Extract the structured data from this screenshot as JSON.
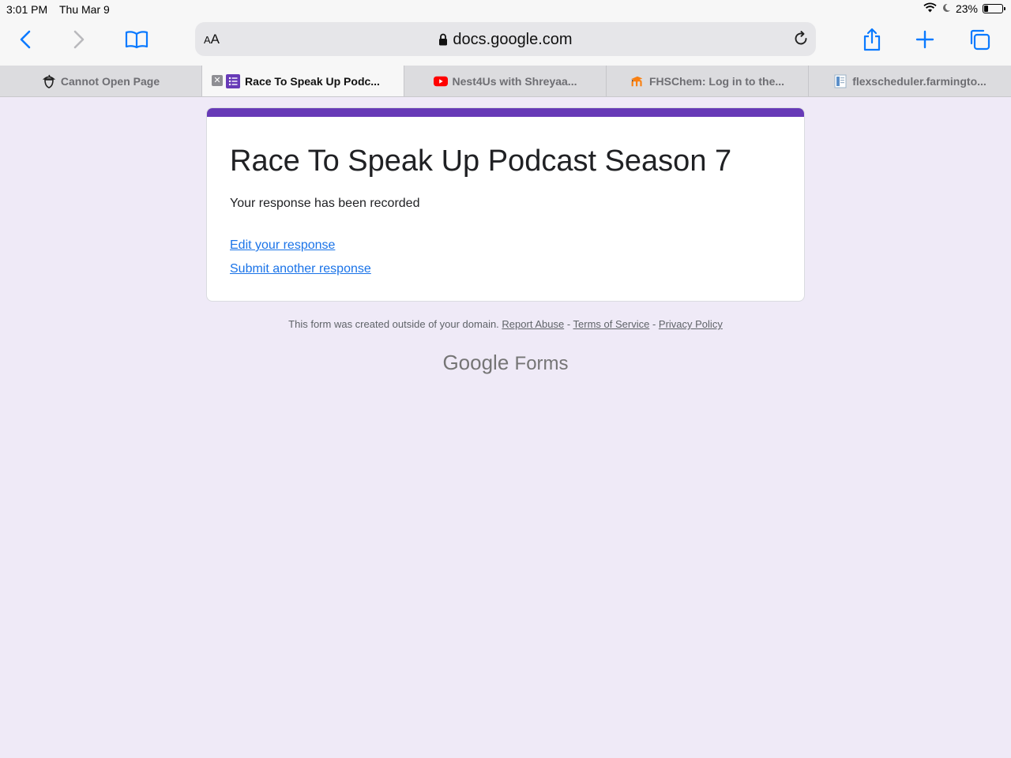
{
  "status_bar": {
    "time": "3:01 PM",
    "date": "Thu Mar 9",
    "battery": "23%",
    "battery_level": 0.23
  },
  "browser": {
    "reader_label_small": "A",
    "reader_label_large": "A",
    "url_domain": "docs.google.com",
    "tabs": [
      {
        "label": "Cannot Open Page",
        "icon": "acorn-icon",
        "active": false
      },
      {
        "label": "Race To Speak Up Podc...",
        "icon": "google-forms-icon",
        "active": true
      },
      {
        "label": "Nest4Us with Shreyaa...",
        "icon": "youtube-icon",
        "active": false
      },
      {
        "label": "FHSChem: Log in to the...",
        "icon": "moodle-icon",
        "active": false
      },
      {
        "label": "flexscheduler.farmingto...",
        "icon": "document-icon",
        "active": false
      }
    ]
  },
  "form": {
    "title": "Race To Speak Up Podcast Season 7",
    "confirmation": "Your response has been recorded",
    "edit_link": "Edit your response",
    "submit_another_link": "Submit another response",
    "accent_color": "#673ab7"
  },
  "footer": {
    "note": "This form was created outside of your domain.",
    "report_abuse": "Report Abuse",
    "separator": " - ",
    "terms": "Terms of Service",
    "privacy": "Privacy Policy",
    "brand_google": "Google",
    "brand_forms": "Forms"
  }
}
